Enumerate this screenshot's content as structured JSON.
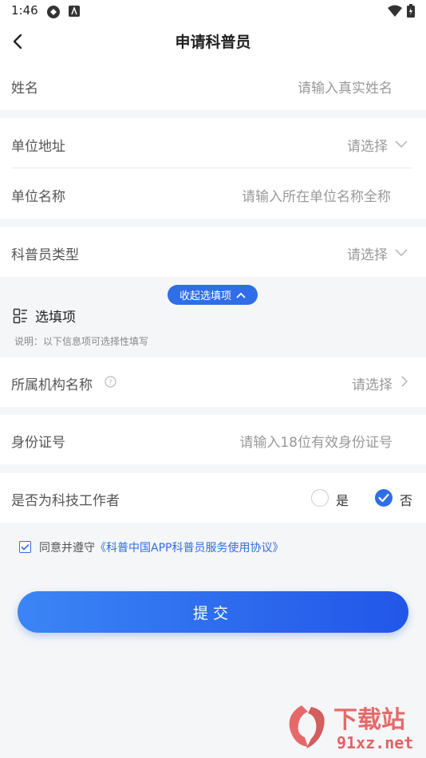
{
  "status_bar": {
    "time": "1:46"
  },
  "header": {
    "title": "申请科普员"
  },
  "form": {
    "name": {
      "label": "姓名",
      "placeholder": "请输入真实姓名"
    },
    "unit_address": {
      "label": "单位地址",
      "value": "请选择"
    },
    "unit_name": {
      "label": "单位名称",
      "placeholder": "请输入所在单位名称全称"
    },
    "staff_type": {
      "label": "科普员类型",
      "value": "请选择"
    }
  },
  "optional": {
    "collapse_label": "收起选填项",
    "title": "选填项",
    "note": "说明：以下信息项可选择性填写",
    "org_name": {
      "label": "所属机构名称",
      "value": "请选择"
    },
    "id_number": {
      "label": "身份证号",
      "placeholder": "请输入18位有效身份证号"
    },
    "tech_worker": {
      "label": "是否为科技工作者",
      "yes_label": "是",
      "no_label": "否",
      "selected": "否"
    }
  },
  "agreement": {
    "prefix": "同意并遵守",
    "link": "《科普中国APP科普员服务使用协议》",
    "checked": true
  },
  "submit": {
    "label": "提交"
  },
  "watermark": {
    "text": "下载站",
    "site": "91xz.net"
  },
  "colors": {
    "accent": "#2f6ee6",
    "background": "#f5f6f8"
  }
}
